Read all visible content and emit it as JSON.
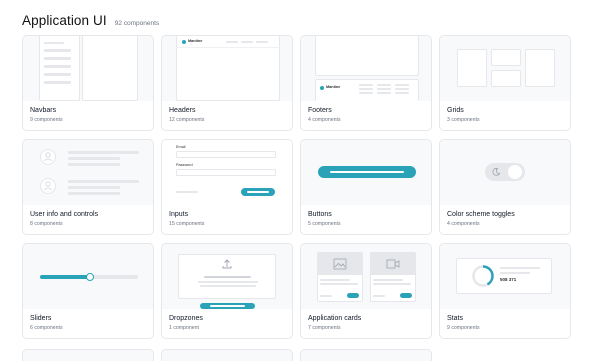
{
  "page": {
    "title": "Application UI",
    "count": "92 components"
  },
  "cards": [
    {
      "title": "Navbars",
      "sub": "9 components"
    },
    {
      "title": "Headers",
      "sub": "12 components"
    },
    {
      "title": "Footers",
      "sub": "4 components"
    },
    {
      "title": "Grids",
      "sub": "3 components"
    },
    {
      "title": "User info and controls",
      "sub": "8 components"
    },
    {
      "title": "Inputs",
      "sub": "15 components"
    },
    {
      "title": "Buttons",
      "sub": "5 components"
    },
    {
      "title": "Color scheme toggles",
      "sub": "4 components"
    },
    {
      "title": "Sliders",
      "sub": "6 components"
    },
    {
      "title": "Dropzones",
      "sub": "1 component"
    },
    {
      "title": "Application cards",
      "sub": "7 components"
    },
    {
      "title": "Stats",
      "sub": "9 components"
    }
  ],
  "previews": {
    "brand": "Mantine",
    "email_label": "Email",
    "password_label": "Password",
    "stat_value": "508 371"
  },
  "colors": {
    "accent": "#2aa3b8",
    "background": "#f8f9fa",
    "border": "#e5e7eb"
  }
}
